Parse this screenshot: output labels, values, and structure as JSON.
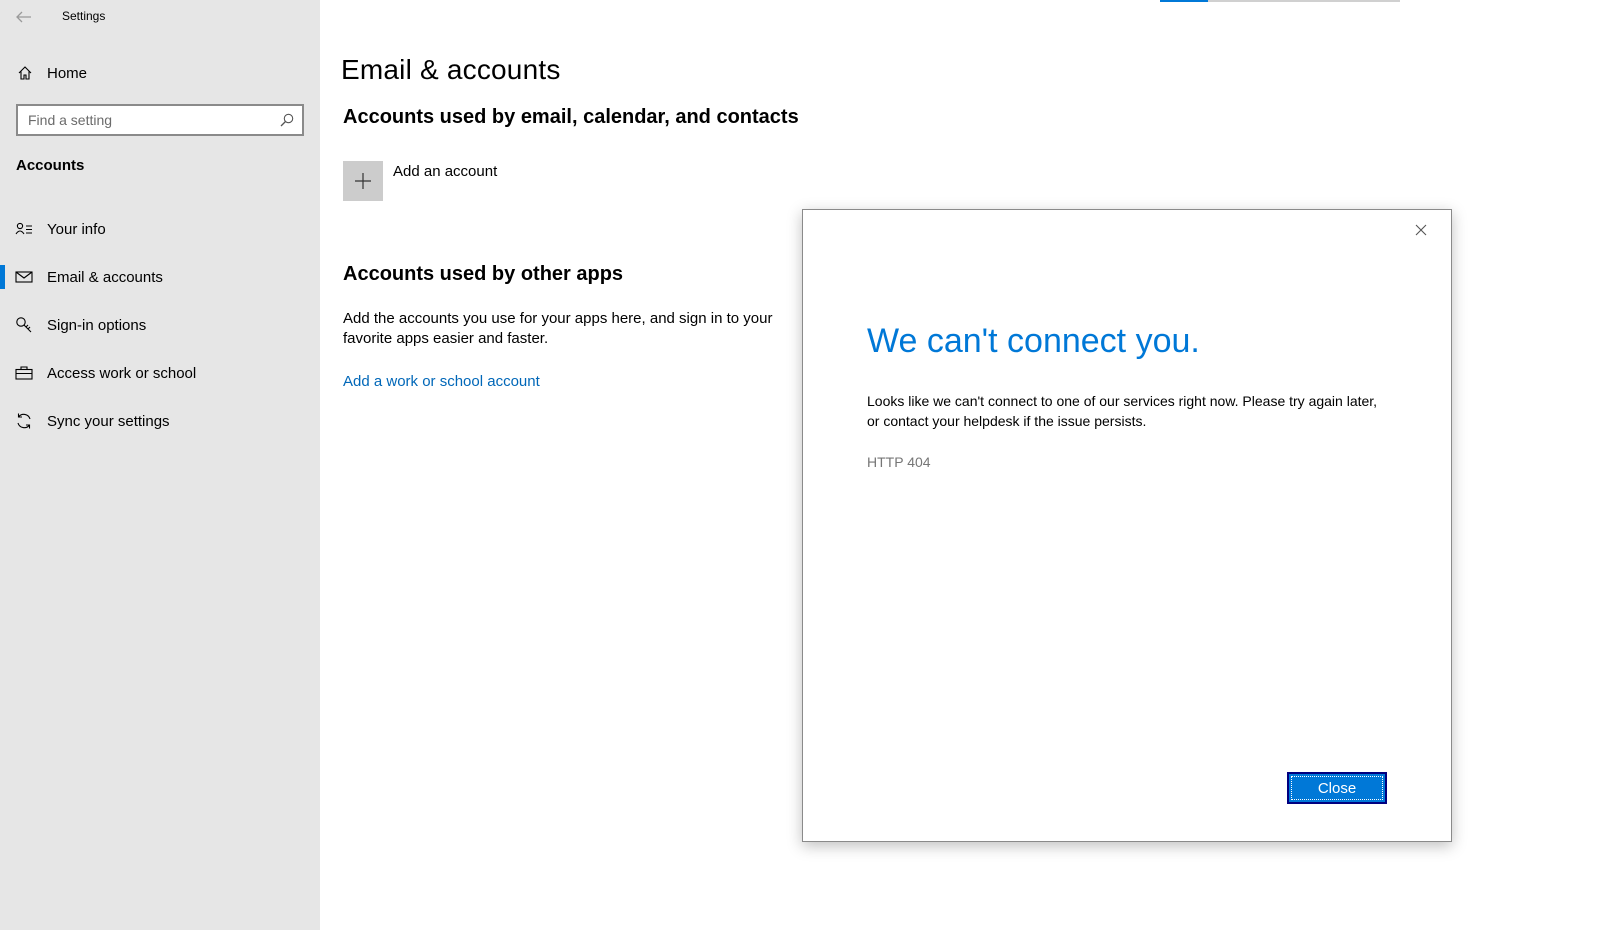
{
  "window": {
    "title": "Settings"
  },
  "sidebar": {
    "home_label": "Home",
    "search": {
      "placeholder": "Find a setting",
      "value": ""
    },
    "section_label": "Accounts",
    "items": [
      {
        "label": "Your info",
        "icon": "person-list-icon",
        "selected": false
      },
      {
        "label": "Email & accounts",
        "icon": "mail-icon",
        "selected": true
      },
      {
        "label": "Sign-in options",
        "icon": "key-icon",
        "selected": false
      },
      {
        "label": "Access work or school",
        "icon": "briefcase-icon",
        "selected": false
      },
      {
        "label": "Sync your settings",
        "icon": "sync-icon",
        "selected": false
      }
    ]
  },
  "main": {
    "title": "Email & accounts",
    "email_section": {
      "heading": "Accounts used by email, calendar, and contacts",
      "add_label": "Add an account"
    },
    "other_section": {
      "heading": "Accounts used by other apps",
      "description": "Add the accounts you use for your apps here, and sign in to your favorite apps easier and faster.",
      "link": "Add a work or school account"
    }
  },
  "dialog": {
    "title": "We can't connect you.",
    "message": "Looks like we can't connect to one of our services right now. Please try again later, or contact your helpdesk if the issue persists.",
    "code": "HTTP 404",
    "button_label": "Close"
  },
  "colors": {
    "accent": "#0078d7",
    "link": "#0067b8",
    "sidebar_bg": "#e6e6e6"
  }
}
